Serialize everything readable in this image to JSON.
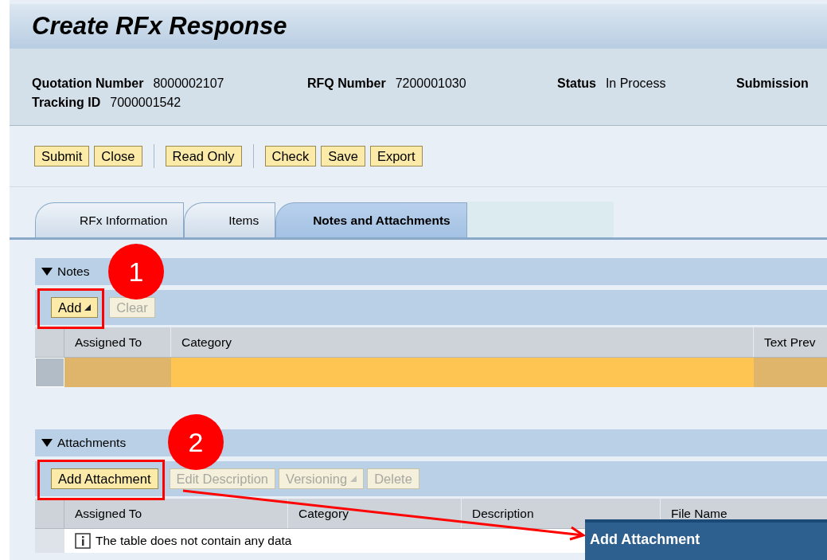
{
  "title": "Create RFx Response",
  "header": {
    "fields": [
      {
        "label": "Quotation Number",
        "value": "8000002107"
      },
      {
        "label": "RFQ Number",
        "value": "7200001030"
      },
      {
        "label": "Status",
        "value": "In Process"
      },
      {
        "label": "Submission"
      }
    ],
    "second_line": {
      "label": "Tracking ID",
      "value": "7000001542"
    }
  },
  "toolbar": [
    [
      "Submit",
      "Close"
    ],
    [
      "Read Only"
    ],
    [
      "Check",
      "Save",
      "Export"
    ]
  ],
  "tabs": [
    {
      "label": "RFx Information",
      "selected": false
    },
    {
      "label": "Items",
      "selected": false
    },
    {
      "label": "Notes and Attachments",
      "selected": true
    }
  ],
  "notes": {
    "title": "Notes",
    "expanded": true,
    "buttons": [
      {
        "label": "Add",
        "disabled": false,
        "menu": true
      },
      {
        "label": "Clear",
        "disabled": true,
        "menu": false
      }
    ],
    "columns": [
      "Assigned To",
      "Category",
      "Text Prev"
    ],
    "rows": [
      {
        "selected": true
      }
    ]
  },
  "attachments": {
    "title": "Attachments",
    "expanded": true,
    "buttons": [
      {
        "label": "Add Attachment",
        "disabled": false,
        "menu": false
      },
      {
        "label": "Edit Description",
        "disabled": true,
        "menu": false
      },
      {
        "label": "Versioning",
        "disabled": true,
        "menu": true
      },
      {
        "label": "Delete",
        "disabled": true,
        "menu": false
      }
    ],
    "columns": [
      "Assigned To",
      "Category",
      "Description",
      "File Name"
    ],
    "empty_message": "The table does not contain any data"
  },
  "callouts": [
    {
      "number": "1"
    },
    {
      "number": "2"
    }
  ],
  "popup": {
    "title": "Add Attachment"
  }
}
